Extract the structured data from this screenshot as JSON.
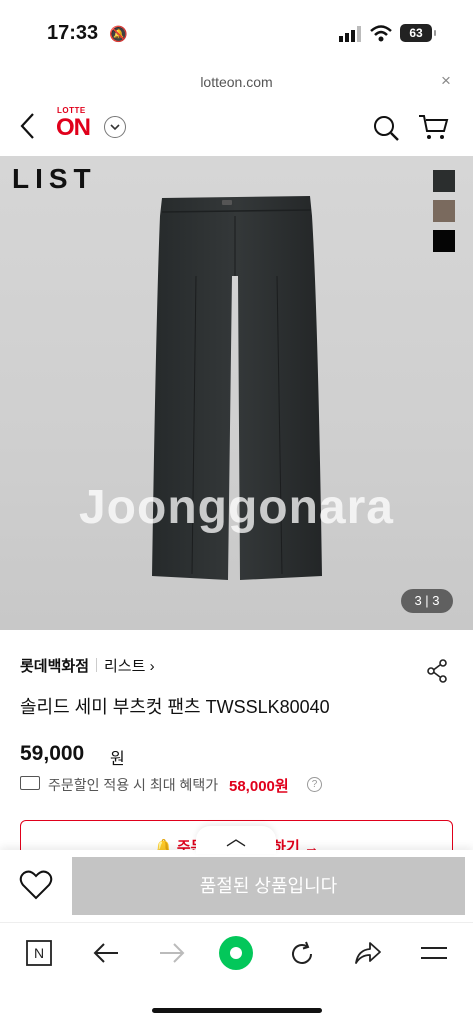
{
  "status": {
    "time": "17:33",
    "battery": "63"
  },
  "browser": {
    "url": "lotteon.com",
    "close_glyph": "×"
  },
  "header": {
    "logo_top": "LOTTE",
    "logo_main": "ON"
  },
  "product": {
    "brand_overlay": "LIST",
    "watermark": "Joonggonara",
    "image_counter": "3 | 3",
    "swatch_colors": [
      "#2b2e2e",
      "#7a6a5e",
      "#050505"
    ],
    "store": "롯데백화점",
    "sub_brand": "리스트 ›",
    "title": "솔리드 세미 부츠컷 팬츠 TWSSLK80040",
    "price": "59,000",
    "currency": "원",
    "discount_text": "주문할인 적용 시 최대 혜택가",
    "discount_price": "58,000원",
    "coupon_text": "🔔 주문 시 즈    확인하기 →"
  },
  "purchase": {
    "soldout_label": "품절된 상품입니다"
  },
  "colors": {
    "brand_red": "#e0001b",
    "naver_green": "#03c75a"
  }
}
